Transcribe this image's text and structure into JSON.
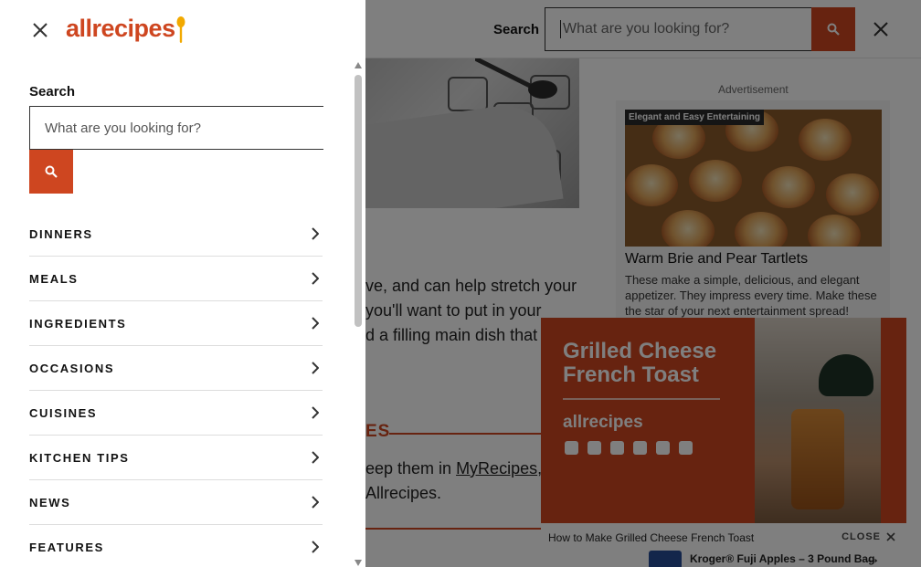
{
  "drawer": {
    "logo": "allrecipes",
    "search_label": "Search",
    "search_placeholder": "What are you looking for?",
    "nav": [
      {
        "label": "DINNERS"
      },
      {
        "label": "MEALS"
      },
      {
        "label": "INGREDIENTS"
      },
      {
        "label": "OCCASIONS"
      },
      {
        "label": "CUISINES"
      },
      {
        "label": "KITCHEN TIPS"
      },
      {
        "label": "NEWS"
      },
      {
        "label": "FEATURES"
      }
    ]
  },
  "header": {
    "search_label": "Search",
    "search_placeholder": "What are you looking for?"
  },
  "article": {
    "text_lines": [
      "ve, and can help stretch your",
      "you'll want to put in your",
      "d a filling main dish that w"
    ],
    "section_heading": "ES",
    "text2_prefix": "eep them in ",
    "text2_link": "MyRecipes",
    "text2_suffix": ",",
    "text2_line2": "Allrecipes."
  },
  "ad": {
    "label": "Advertisement",
    "tag": "Elegant and Easy Entertaining",
    "title": "Warm Brie and Pear Tartlets",
    "description": "These make a simple, delicious, and elegant appetizer. They impress every time. Make these the star of your next entertainment spread!"
  },
  "video": {
    "title": "Grilled Cheese French Toast",
    "brand": "allrecipes",
    "caption": "How to Make Grilled Cheese French Toast",
    "close_label": "CLOSE"
  },
  "promo": {
    "text": "Kroger® Fuji Apples – 3 Pound Bag"
  },
  "colors": {
    "brand": "#ce4620",
    "overlay": "rgba(0,0,0,0.5)"
  }
}
